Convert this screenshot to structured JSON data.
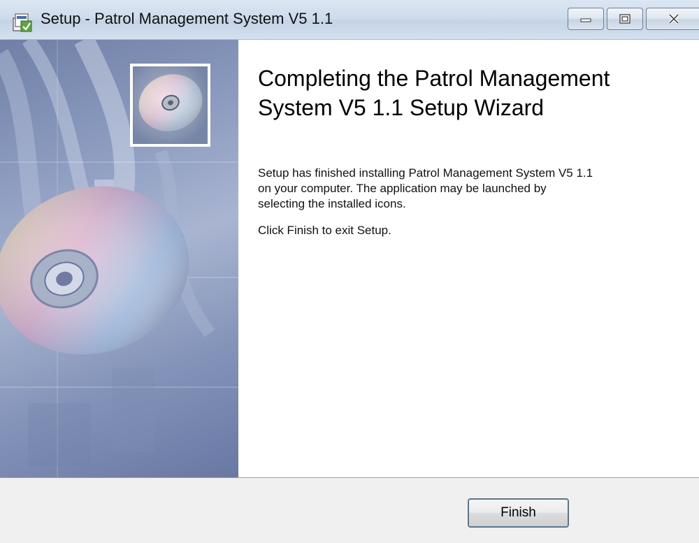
{
  "window": {
    "title": "Setup - Patrol Management System V5 1.1",
    "icons": {
      "app": "installer-icon",
      "minimize": "minimize-icon",
      "maximize": "maximize-icon",
      "close": "close-icon"
    }
  },
  "banner": {
    "image": "cd-disc-banner"
  },
  "content": {
    "heading_line1": "Completing the Patrol Management",
    "heading_line2": "System V5 1.1 Setup Wizard",
    "body_line1": "Setup has finished installing Patrol Management System V5 1.1",
    "body_line2": "on your computer. The application may be launched by",
    "body_line3": "selecting the installed icons.",
    "exit_instruction": "Click Finish to exit Setup."
  },
  "footer": {
    "finish_label": "Finish"
  },
  "colors": {
    "titlebar": "#cfdcec",
    "banner_blue": "#8d9cc0",
    "footer_bg": "#f0f0f0"
  }
}
